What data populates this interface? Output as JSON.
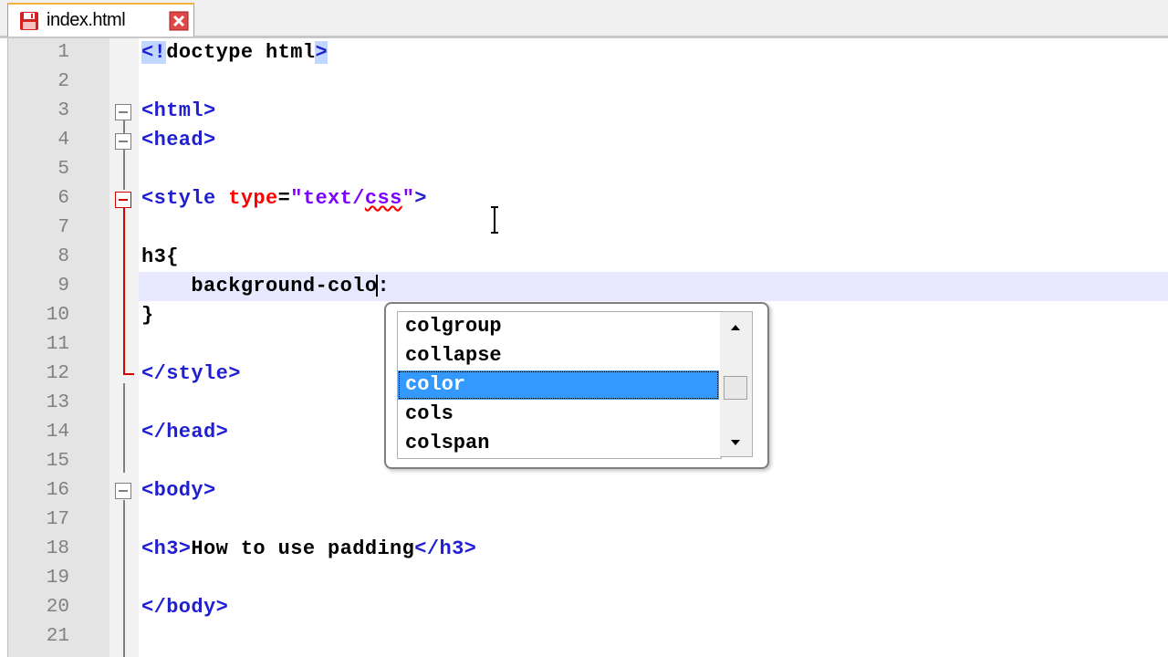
{
  "tab": {
    "filename": "index.html",
    "icon": "floppy-disk-red-icon",
    "close_icon": "close-x-icon"
  },
  "lines": [
    {
      "num": "1"
    },
    {
      "num": "2"
    },
    {
      "num": "3"
    },
    {
      "num": "4"
    },
    {
      "num": "5"
    },
    {
      "num": "6"
    },
    {
      "num": "7"
    },
    {
      "num": "8"
    },
    {
      "num": "9"
    },
    {
      "num": "10"
    },
    {
      "num": "11"
    },
    {
      "num": "12"
    },
    {
      "num": "13"
    },
    {
      "num": "14"
    },
    {
      "num": "15"
    },
    {
      "num": "16"
    },
    {
      "num": "17"
    },
    {
      "num": "18"
    },
    {
      "num": "19"
    },
    {
      "num": "20"
    },
    {
      "num": "21"
    }
  ],
  "code": {
    "l1_open": "<!",
    "l1_rest": "doctype html",
    "l1_close": ">",
    "l3": "<html>",
    "l4": "<head>",
    "l6_tag": "<style ",
    "l6_attr": "type",
    "l6_eq": "=",
    "l6_val_a": "\"text/",
    "l6_val_b": "css",
    "l6_val_c": "\"",
    "l6_close": ">",
    "l8": "h3{",
    "l9_indent": "    ",
    "l9_before_caret": "background-colo",
    "l9_after_caret": ":",
    "l10": "}",
    "l12": "</style>",
    "l14": "</head>",
    "l16": "<body>",
    "l18_open": "<h3>",
    "l18_text": "How to use padding",
    "l18_close": "</h3>",
    "l20": "</body>"
  },
  "autocomplete": {
    "items": [
      "colgroup",
      "collapse",
      "color",
      "cols",
      "colspan"
    ],
    "selected": "color"
  },
  "colors": {
    "tag": "#1f1fd1",
    "attribute": "#ff0000",
    "string": "#8000ff",
    "selection": "#3399ff",
    "current_line": "#e8e8ff"
  }
}
